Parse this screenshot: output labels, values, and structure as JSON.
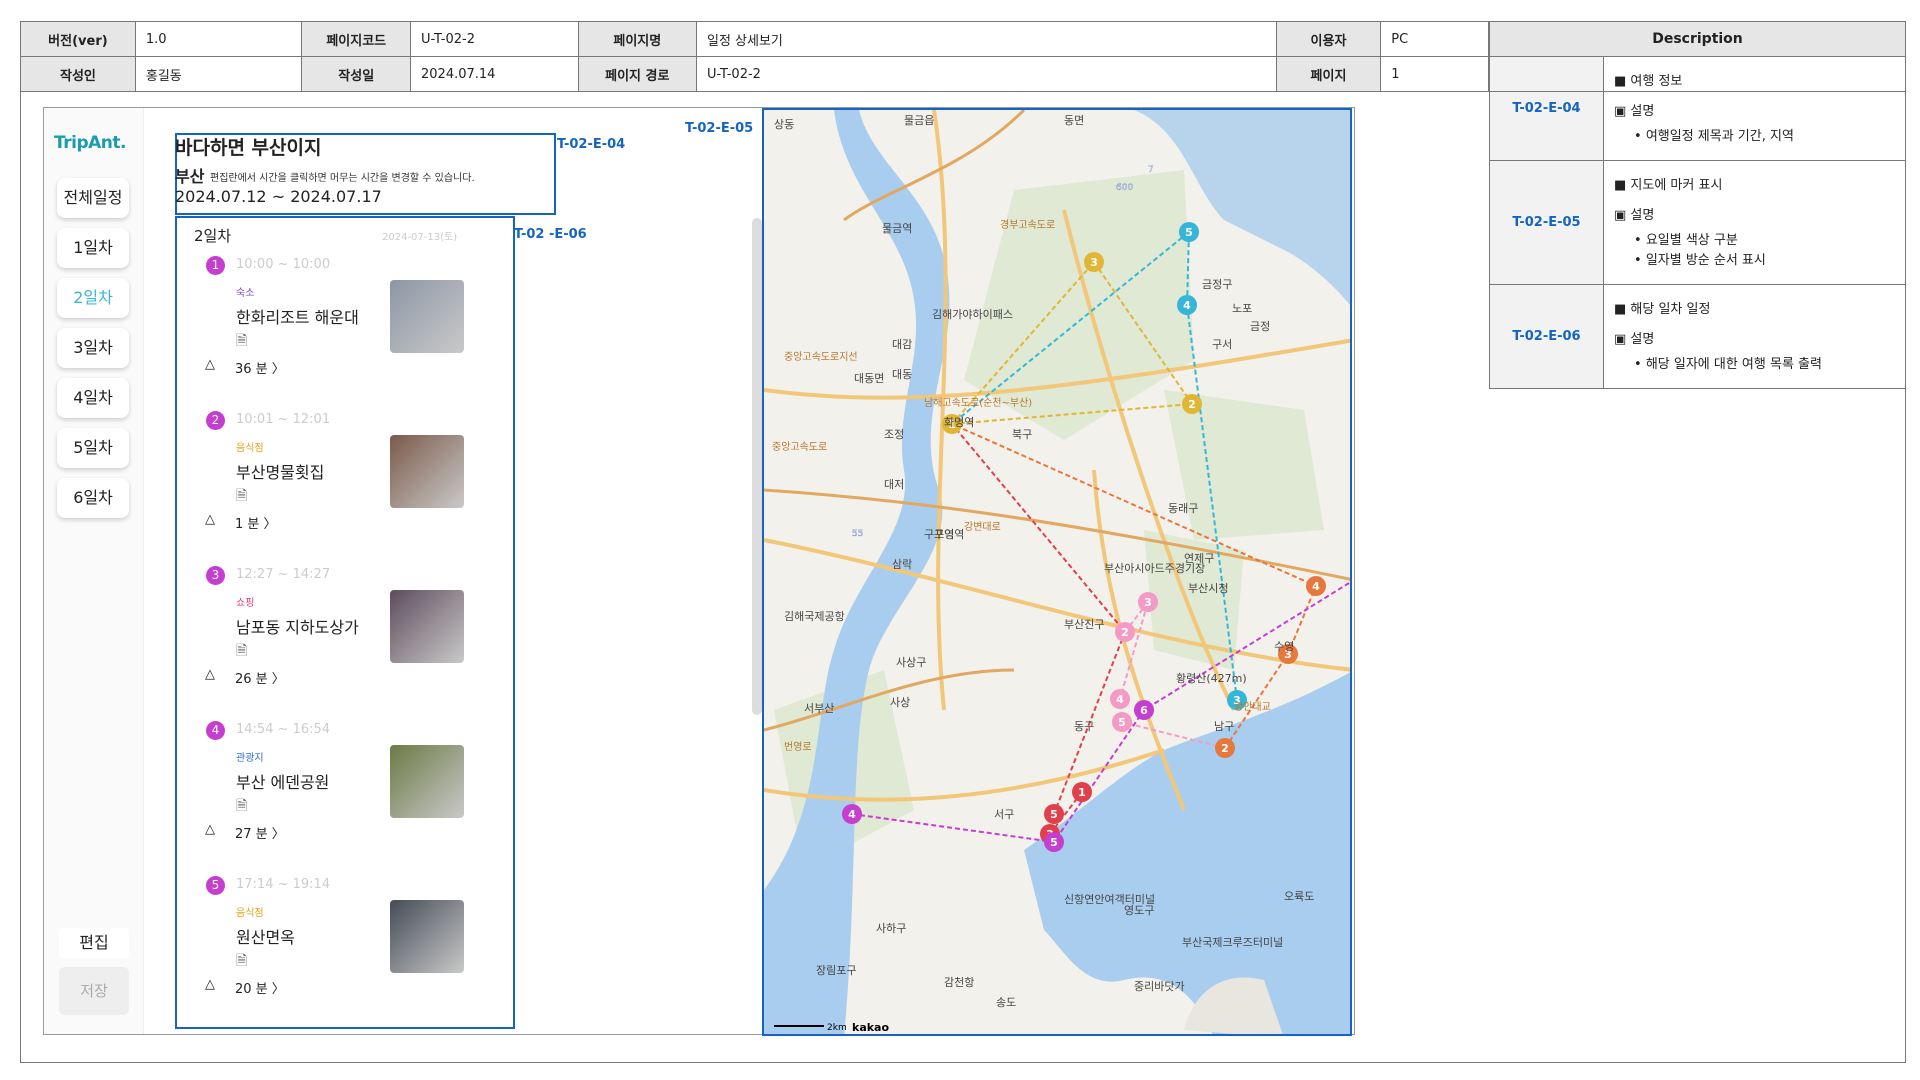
{
  "header": {
    "version_label": "버전(ver)",
    "version": "1.0",
    "page_code_label": "페이지코드",
    "page_code": "U-T-02-2",
    "page_name_label": "페이지명",
    "page_name": "일정 상세보기",
    "user_label": "이용자",
    "user": "PC",
    "author_label": "작성인",
    "author": "홍길동",
    "date_label": "작성일",
    "date": "2024.07.14",
    "path_label": "페이지 경로",
    "path": "U-T-02-2",
    "page_label": "페이지",
    "page": "1"
  },
  "description": {
    "title": "Description",
    "rows": [
      {
        "id": "T-02-E-04",
        "head": "■ 여행 정보",
        "sub": "▣ 설명",
        "items": [
          "여행일정 제목과 기간, 지역"
        ]
      },
      {
        "id": "T-02-E-05",
        "head": "■ 지도에 마커 표시",
        "sub": "▣ 설명",
        "items": [
          "요일별 색상 구분",
          "일자별 방순 순서 표시"
        ]
      },
      {
        "id": "T-02-E-06",
        "head": "■ 해당 일차 일정",
        "sub": "▣ 설명",
        "items": [
          "해당 일자에 대한 여행 목록 출력"
        ]
      }
    ]
  },
  "app": {
    "logo": "TripAnt.",
    "days": [
      "전체일정",
      "1일차",
      "2일차",
      "3일차",
      "4일차",
      "5일차",
      "6일차"
    ],
    "active_day": "2일차",
    "edit": "편집",
    "save": "저장"
  },
  "trip": {
    "title": "바다하면 부산이지",
    "region": "부산",
    "hint": "편집란에서 시간을 클릭하면 머무는 시간을 변경할 수 있습니다.",
    "dates": "2024.07.12 ~ 2024.07.17"
  },
  "labels": {
    "e04": "T-02-E-04",
    "e05": "T-02-E-05",
    "e06": "T-02 -E-06"
  },
  "itinerary": {
    "day": "2일차",
    "date": "2024-07-13(토)",
    "items": [
      {
        "num": "1",
        "time": "10:00 ~ 10:00",
        "category": "숙소",
        "cat_color": "#7b3fd1",
        "name": "한화리조트 해운대",
        "duration": "36 분 〉"
      },
      {
        "num": "2",
        "time": "10:01 ~ 12:01",
        "category": "음식점",
        "cat_color": "#e6a21a",
        "name": "부산명물횟집",
        "duration": "1 분 〉"
      },
      {
        "num": "3",
        "time": "12:27 ~ 14:27",
        "category": "쇼핑",
        "cat_color": "#e03c78",
        "name": "남포동 지하도상가",
        "duration": "26 분 〉"
      },
      {
        "num": "4",
        "time": "14:54 ~ 16:54",
        "category": "관광지",
        "cat_color": "#2a6fd6",
        "name": "부산 에덴공원",
        "duration": "27 분 〉"
      },
      {
        "num": "5",
        "time": "17:14 ~ 19:14",
        "category": "음식점",
        "cat_color": "#e6a21a",
        "name": "원산면옥",
        "duration": "20 분 〉"
      }
    ]
  },
  "map": {
    "places": [
      "물금읍",
      "동면",
      "대동면",
      "북구",
      "구포역",
      "동래구",
      "연제구",
      "부산시청",
      "부산진구",
      "사상구",
      "서부산",
      "동구",
      "남구",
      "수영",
      "사하구",
      "서구",
      "영도구",
      "감천항",
      "송도",
      "장림포구",
      "중리바닷가",
      "부산국제크루즈터미널",
      "신항연안여객터미널",
      "김해국제공항",
      "황령산(427m)",
      "오륙도",
      "금정구",
      "구서",
      "노포",
      "금정",
      "부산아시아드주경기장",
      "상동",
      "김해가야하이패스",
      "대감",
      "대동",
      "조정",
      "대저",
      "삼락",
      "사상",
      "물금역",
      "구영역",
      "화명역"
    ],
    "roads": [
      "경부고속도로",
      "남해고속도로(순천~부산)",
      "중앙고속도로지선",
      "중앙고속도로",
      "번영로",
      "강변대로",
      "광안대교"
    ],
    "highways": [
      "600",
      "7",
      "55"
    ],
    "scale": "2km",
    "brand": "kakao",
    "markers": [
      {
        "day": "gold",
        "num": "1"
      },
      {
        "day": "gold",
        "num": "2"
      },
      {
        "day": "gold",
        "num": "3"
      },
      {
        "day": "cyan",
        "num": "3"
      },
      {
        "day": "cyan",
        "num": "4"
      },
      {
        "day": "cyan",
        "num": "5"
      },
      {
        "day": "orange",
        "num": "2"
      },
      {
        "day": "orange",
        "num": "3"
      },
      {
        "day": "orange",
        "num": "4"
      },
      {
        "day": "red",
        "num": "1"
      },
      {
        "day": "red",
        "num": "3"
      },
      {
        "day": "red",
        "num": "5"
      },
      {
        "day": "pink",
        "num": "2"
      },
      {
        "day": "pink",
        "num": "3"
      },
      {
        "day": "pink",
        "num": "4"
      },
      {
        "day": "pink",
        "num": "5"
      },
      {
        "day": "magenta",
        "num": "4"
      },
      {
        "day": "magenta",
        "num": "5"
      },
      {
        "day": "magenta",
        "num": "6"
      }
    ],
    "colors": {
      "gold": "#e0b634",
      "cyan": "#35b6d8",
      "orange": "#e6773d",
      "red": "#e0404a",
      "pink": "#f39bc4",
      "magenta": "#c53ecf"
    }
  }
}
